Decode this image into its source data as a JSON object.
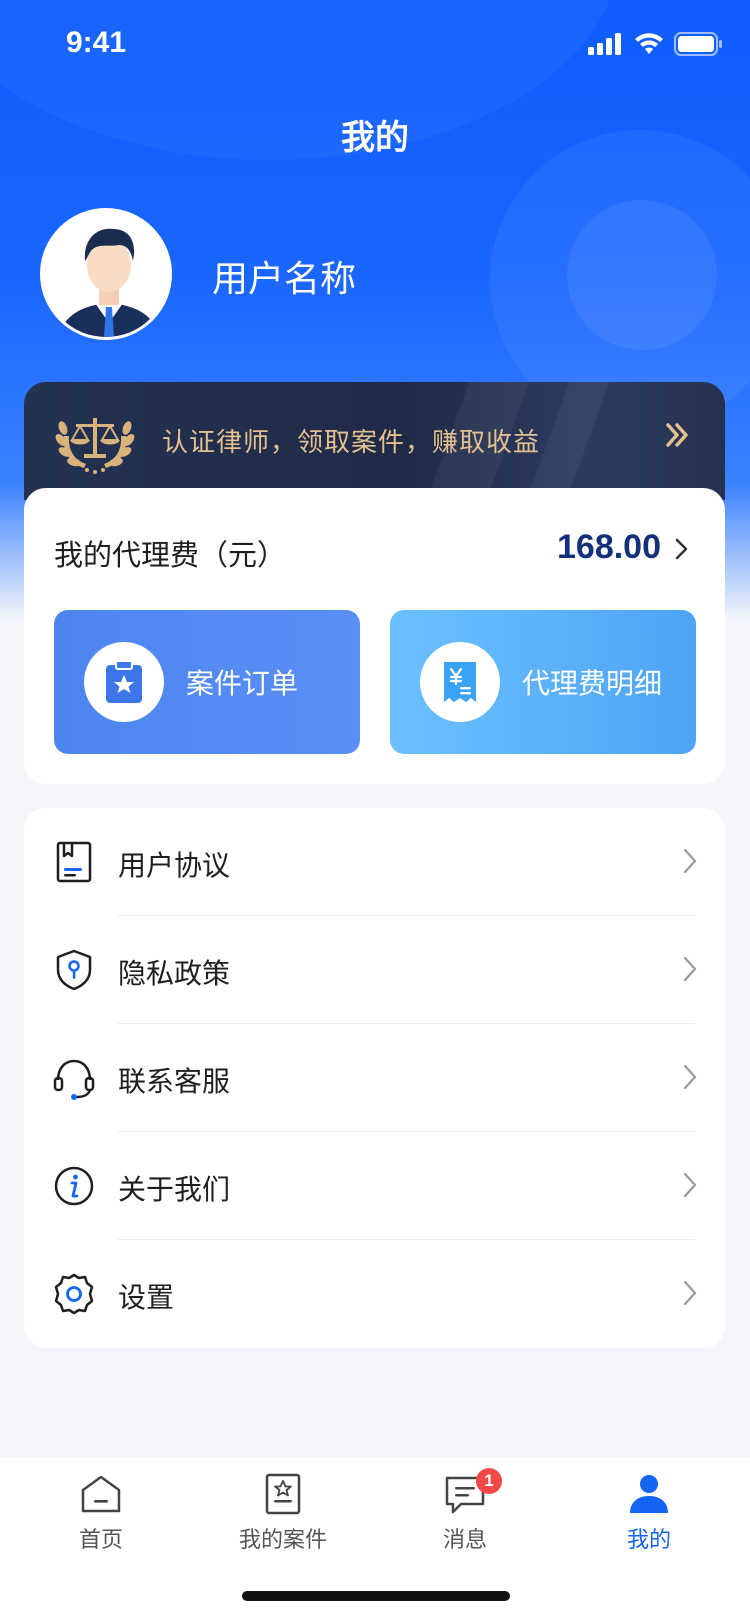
{
  "status_bar": {
    "time": "9:41"
  },
  "header": {
    "title": "我的"
  },
  "profile": {
    "username": "用户名称"
  },
  "promo": {
    "text": "认证律师，领取案件，赚取收益"
  },
  "fee": {
    "label": "我的代理费（元）",
    "amount": "168.00"
  },
  "quick_actions": [
    {
      "label": "案件订单",
      "icon": "clipboard-star-icon"
    },
    {
      "label": "代理费明细",
      "icon": "receipt-yen-icon"
    }
  ],
  "menu": [
    {
      "label": "用户协议",
      "icon": "agreement-book-icon"
    },
    {
      "label": "隐私政策",
      "icon": "privacy-shield-icon"
    },
    {
      "label": "联系客服",
      "icon": "headset-icon"
    },
    {
      "label": "关于我们",
      "icon": "info-icon"
    },
    {
      "label": "设置",
      "icon": "gear-icon"
    }
  ],
  "tabbar": [
    {
      "label": "首页",
      "icon": "home-icon"
    },
    {
      "label": "我的案件",
      "icon": "case-icon"
    },
    {
      "label": "消息",
      "icon": "message-icon",
      "badge": "1"
    },
    {
      "label": "我的",
      "icon": "user-icon",
      "active": true
    }
  ],
  "colors": {
    "primary": "#1565f5",
    "promo_gold": "#e3c08d",
    "amount": "#14307a",
    "badge": "#f24848"
  }
}
